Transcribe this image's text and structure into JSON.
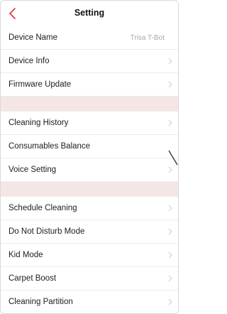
{
  "header": {
    "title": "Setting"
  },
  "groups": [
    {
      "items": [
        {
          "label": "Device Name",
          "value": "Trisa T-Bot"
        },
        {
          "label": "Device Info"
        },
        {
          "label": "Firmware Update"
        }
      ]
    },
    {
      "items": [
        {
          "label": "Cleaning History"
        },
        {
          "label": "Consumables Balance"
        },
        {
          "label": "Voice Setting"
        }
      ]
    },
    {
      "items": [
        {
          "label": "Schedule Cleaning"
        },
        {
          "label": "Do Not Disturb Mode"
        },
        {
          "label": "Kid Mode"
        },
        {
          "label": "Carpet Boost"
        },
        {
          "label": "Cleaning Partition"
        }
      ]
    }
  ],
  "colors": {
    "accent": "#e0323c",
    "separator": "#f5e6e6",
    "chevron": "#cfcfcf"
  },
  "icons": [
    "chevron-left-icon",
    "chevron-right-icon"
  ]
}
